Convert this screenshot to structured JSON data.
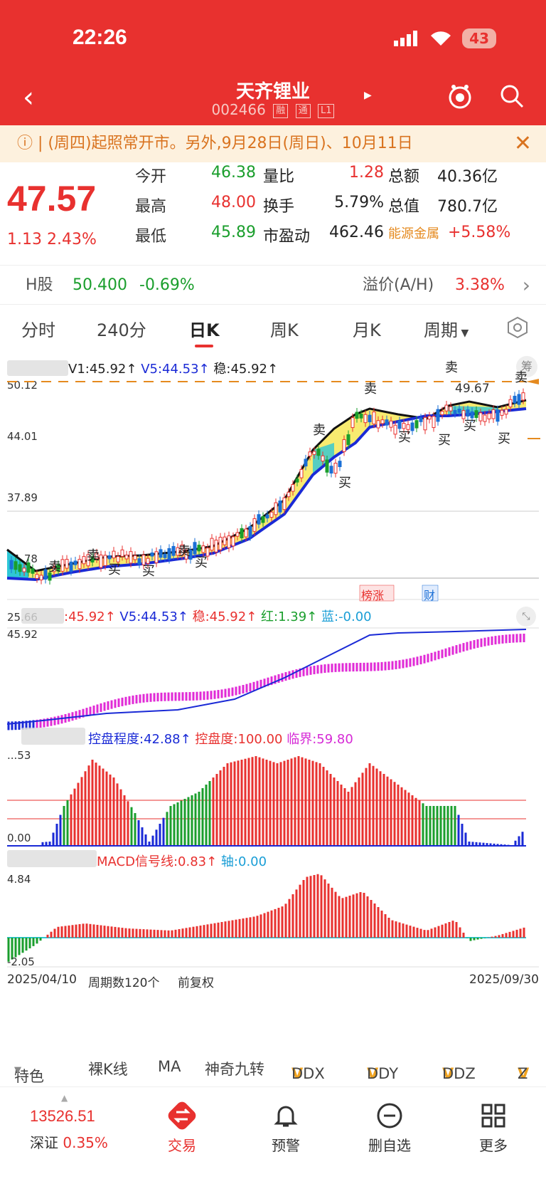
{
  "status": {
    "time": "22:26",
    "battery": "43"
  },
  "nav": {
    "title": "天齐锂业",
    "code": "002466",
    "tags": [
      "融",
      "通",
      "L1"
    ]
  },
  "notice": {
    "text": "(周四)起照常开市。另外,9月28日(周日)、10月11日"
  },
  "quote": {
    "price": "47.57",
    "change": "1.13 2.43%",
    "rows": [
      {
        "l1": "今开",
        "v1": "46.38",
        "l2": "量比",
        "v2": "1.28",
        "l3": "总额",
        "v3": "40.36亿"
      },
      {
        "l1": "最高",
        "v1": "48.00",
        "l2": "换手",
        "v2": "5.79%",
        "l3": "总值",
        "v3": "780.7亿"
      },
      {
        "l1": "最低",
        "v1": "45.89",
        "l2": "市盈动",
        "v2": "462.46",
        "l3": "能源金属",
        "v3": "+5.58%"
      }
    ]
  },
  "hshare": {
    "label": "H股",
    "price": "50.400",
    "change": "-0.69%",
    "premium_label": "溢价(A/H)",
    "premium": "3.38%"
  },
  "tabs": [
    "分时",
    "240分",
    "日K",
    "周K",
    "月K",
    "周期"
  ],
  "chart": {
    "main_legend": {
      "v1": "V1:45.92↑",
      "v5": "V5:44.53↑",
      "stable": "稳:45.92↑"
    },
    "y_labels": [
      "50.12",
      "44.01",
      "37.89",
      "31.78",
      "25.66"
    ],
    "high_label": "49.67",
    "events": [
      "榜涨",
      "财"
    ],
    "sub1_legend": {
      "a": ":45.92↑",
      "v5": "V5:44.53↑",
      "stable": "稳:45.92↑",
      "red": "红:1.39↑",
      "blue": "蓝:-0.00"
    },
    "sub1_y": "45.92",
    "sub2_legend": {
      "a": "控盘程度:42.88↑",
      "b": "控盘度:100.00",
      "c": "临界:59.80"
    },
    "sub2_y_top": "...53",
    "sub2_y_bottom": "0.00",
    "sub3_legend": {
      "a": "MACD信号线:0.83↑",
      "b": "轴:0.00"
    },
    "sub3_y_top": "4.84",
    "sub3_y_bottom": "-2.05",
    "footer": {
      "start": "2025/04/10",
      "periods": "周期数120个",
      "adj": "前复权",
      "end": "2025/09/30"
    },
    "chou": "筹"
  },
  "toolbar": [
    "特色",
    "裸K线",
    "MA",
    "神奇九转",
    "DDX",
    "DDY",
    "DDZ",
    "Z"
  ],
  "bottom": {
    "index_value": "13526.51",
    "index_name": "深证",
    "index_change": "0.35%",
    "items": [
      "交易",
      "预警",
      "删自选",
      "更多"
    ]
  }
}
